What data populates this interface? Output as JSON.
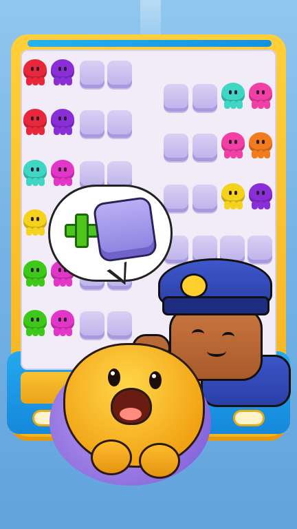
{
  "colors": {
    "red": "#e8283a",
    "purple": "#8a2fd8",
    "teal": "#3fd6c4",
    "magenta": "#e236c8",
    "pink": "#f23fa6",
    "orange": "#f47a1e",
    "yellow": "#f5d21c",
    "green": "#3ec91a",
    "seat": "#c5bcef",
    "accent_blue": "#1a8fe0",
    "frame_yellow": "#f7b91f"
  },
  "board": {
    "left_rows": [
      {
        "row": 1,
        "slots": [
          "red",
          "purple",
          "empty",
          "empty"
        ]
      },
      {
        "row": 2,
        "slots": [
          "red",
          "purple",
          "empty",
          "empty"
        ]
      },
      {
        "row": 3,
        "slots": [
          "teal",
          "magenta",
          "empty",
          "empty"
        ]
      },
      {
        "row": 4,
        "slots": [
          "yellow",
          "hidden",
          "hidden",
          "hidden"
        ]
      },
      {
        "row": 5,
        "slots": [
          "green",
          "magenta",
          "empty",
          "empty"
        ]
      },
      {
        "row": 6,
        "slots": [
          "green",
          "magenta",
          "empty",
          "empty"
        ]
      }
    ],
    "right_rows": [
      {
        "row": 1,
        "slots": [
          "empty",
          "empty",
          "teal",
          "pink"
        ]
      },
      {
        "row": 2,
        "slots": [
          "empty",
          "empty",
          "pink",
          "orange"
        ]
      },
      {
        "row": 3,
        "slots": [
          "empty",
          "empty",
          "yellow",
          "purple"
        ]
      },
      {
        "row": 4,
        "slots": [
          "empty",
          "empty",
          "empty",
          "empty"
        ]
      }
    ]
  },
  "booster_bubble": {
    "icon": "plus-icon",
    "item": "extra-seat-icon"
  },
  "characters": {
    "captain": "bus-captain-character",
    "mascot": "yellow-blob-mascot"
  }
}
